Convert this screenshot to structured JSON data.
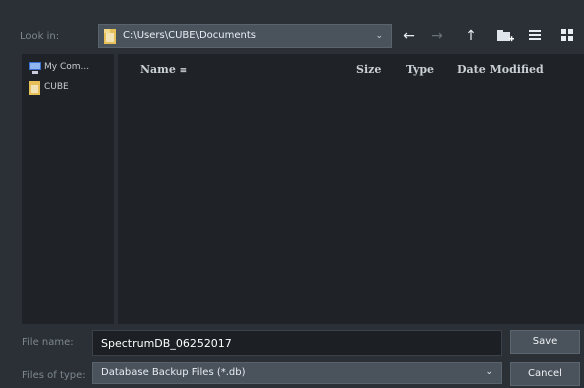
{
  "toolbar": {
    "look_in_label": "Look in:",
    "path": "C:\\Users\\CUBE\\Documents",
    "icons": [
      "back-icon",
      "forward-icon",
      "up-icon",
      "new-folder-icon",
      "list-view-icon",
      "details-view-icon"
    ]
  },
  "places": [
    {
      "label": "My Com..."
    },
    {
      "label": "CUBE"
    }
  ],
  "columns": {
    "name": "Name",
    "size": "Size",
    "type": "Type",
    "date": "Date Modified"
  },
  "bottom": {
    "file_name_label": "File name:",
    "file_name_value": "SpectrumDB_06252017",
    "file_type_label": "Files of type:",
    "file_type_value": "Database Backup Files (*.db)",
    "save_label": "Save",
    "cancel_label": "Cancel"
  },
  "colors": {
    "background": "#2b3036",
    "panel": "#1f2327",
    "control": "#4a535c"
  }
}
